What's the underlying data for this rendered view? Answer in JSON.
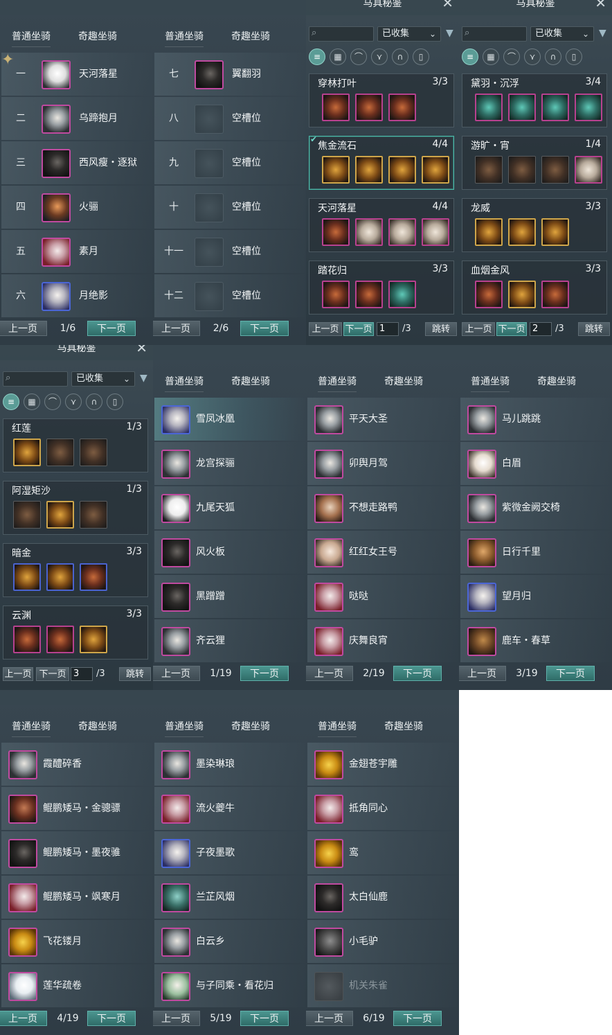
{
  "tabs": {
    "normal": "普通坐骑",
    "fun": "奇趣坐骑"
  },
  "pager": {
    "prev": "上一页",
    "next": "下一页"
  },
  "normal_pages": [
    {
      "page": "1/6",
      "rows": [
        {
          "num": "一",
          "name": "天河落星"
        },
        {
          "num": "二",
          "name": "乌蹄抱月"
        },
        {
          "num": "三",
          "name": "西风瘦・逐狱"
        },
        {
          "num": "四",
          "name": "火骊"
        },
        {
          "num": "五",
          "name": "素月"
        },
        {
          "num": "六",
          "name": "月绝影"
        }
      ]
    },
    {
      "page": "2/6",
      "rows": [
        {
          "num": "七",
          "name": "翼翻羽"
        },
        {
          "num": "八",
          "name": "空槽位"
        },
        {
          "num": "九",
          "name": "空槽位"
        },
        {
          "num": "十",
          "name": "空槽位"
        },
        {
          "num": "十一",
          "name": "空槽位"
        },
        {
          "num": "十二",
          "name": "空槽位"
        }
      ]
    }
  ],
  "harness": {
    "title": "马具秘鉴",
    "filter_value": "已收集",
    "jump": "跳转",
    "total": "/3",
    "pages": [
      {
        "input": "1",
        "sets": [
          {
            "name": "穿林打叶",
            "count": "3/3"
          },
          {
            "name": "焦金流石",
            "count": "4/4"
          },
          {
            "name": "天河落星",
            "count": "4/4"
          },
          {
            "name": "踏花归",
            "count": "3/3"
          }
        ]
      },
      {
        "input": "2",
        "sets": [
          {
            "name": "黛羽・沉浮",
            "count": "3/4"
          },
          {
            "name": "游旷・宵",
            "count": "1/4"
          },
          {
            "name": "龙威",
            "count": "3/3"
          },
          {
            "name": "血烟金风",
            "count": "3/3"
          }
        ]
      },
      {
        "input": "3",
        "sets": [
          {
            "name": "红莲",
            "count": "1/3"
          },
          {
            "name": "阿湿矩沙",
            "count": "1/3"
          },
          {
            "name": "暗金",
            "count": "3/3"
          },
          {
            "name": "云渊",
            "count": "3/3"
          }
        ]
      }
    ]
  },
  "fun_pages": [
    {
      "page": "1/19",
      "rows": [
        "雪凤冰凰",
        "龙宫探骊",
        "九尾天狐",
        "风火板",
        "黑蹭蹭",
        "齐云狸"
      ]
    },
    {
      "page": "2/19",
      "rows": [
        "平天大圣",
        "卯舆月驾",
        "不想走路鸭",
        "红红女王号",
        "哒哒",
        "庆舞良宵"
      ]
    },
    {
      "page": "3/19",
      "rows": [
        "马儿跳跳",
        "白眉",
        "紫微金阙交椅",
        "日行千里",
        "望月归",
        "鹿车・春草"
      ]
    },
    {
      "page": "4/19",
      "rows": [
        "霞醴碎香",
        "鲲鹏矮马・金骢骠",
        "鲲鹏矮马・墨夜骓",
        "鲲鹏矮马・飒寒月",
        "飞花镂月",
        "莲华疏卷"
      ]
    },
    {
      "page": "5/19",
      "rows": [
        "墨染琳琅",
        "流火夔牛",
        "子夜墨歌",
        "兰芷风烟",
        "白云乡",
        "与子同乘・看花归"
      ]
    },
    {
      "page": "6/19",
      "rows": [
        "金翅苍宇雕",
        "抵角同心",
        "鸾",
        "太白仙鹿",
        "小毛驴",
        "机关朱雀"
      ]
    }
  ],
  "icons": {
    "search": "search-icon",
    "dropdown": "chevron-down-icon",
    "filter": "funnel-icon",
    "close": "close-icon",
    "filter_tabs": [
      "list-icon",
      "grid-icon",
      "saddle-icon",
      "bridle-icon",
      "horseshoe-icon",
      "armor-icon"
    ]
  },
  "colors": {
    "accent": "#4c9690",
    "rarity_purple": "#c04aa0",
    "rarity_blue": "#4b66d6",
    "rarity_gold": "#cfa64a"
  }
}
